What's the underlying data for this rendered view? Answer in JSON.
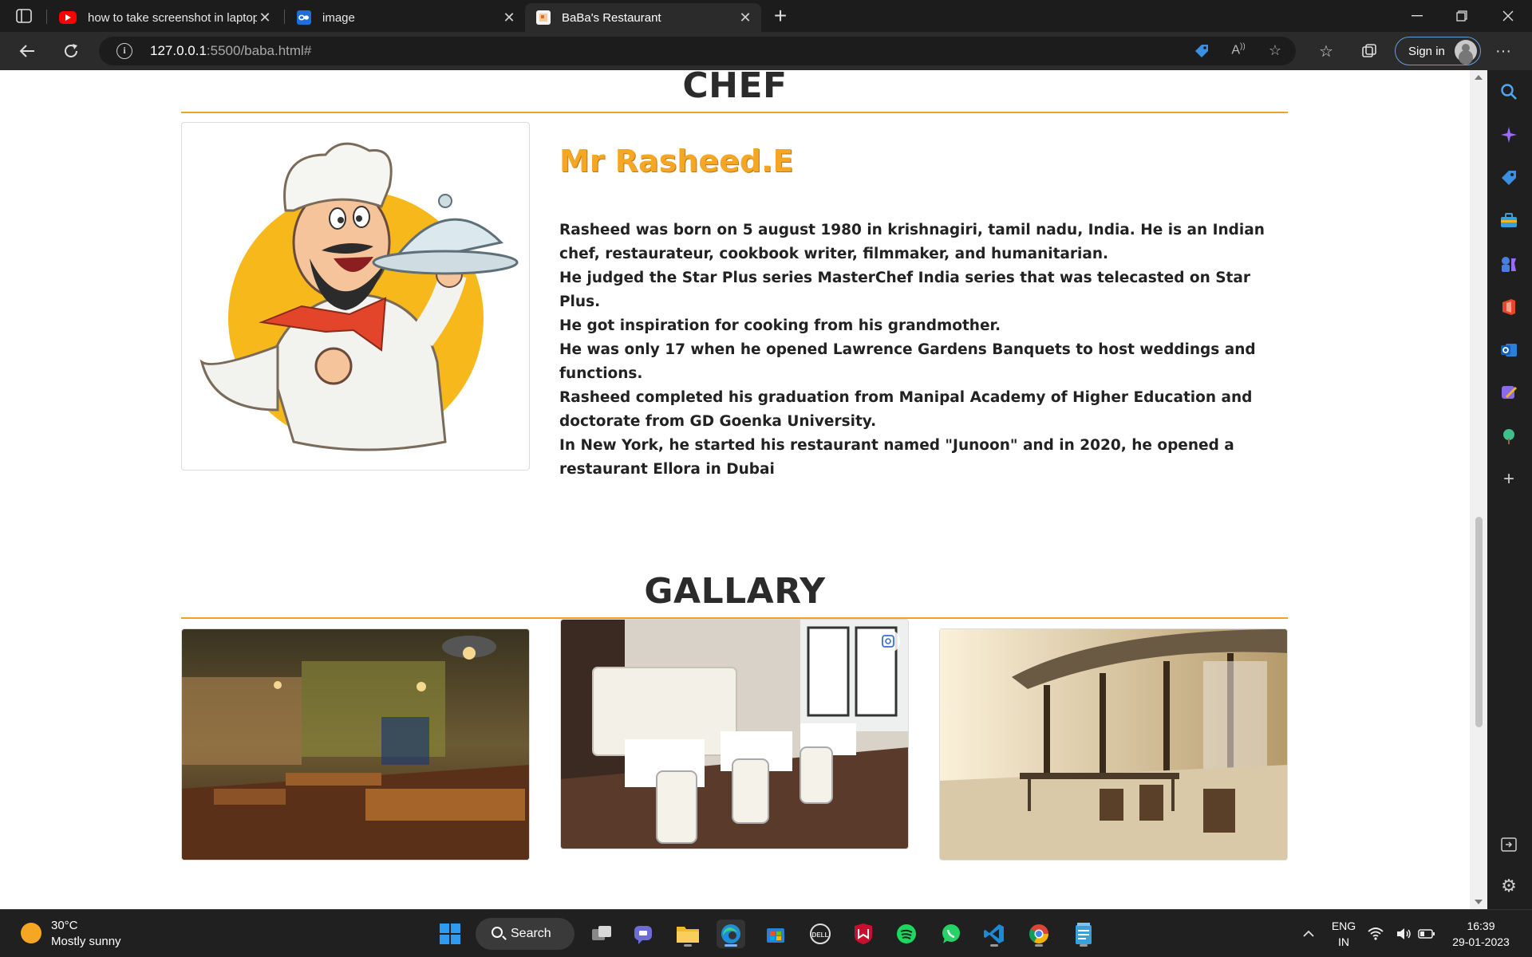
{
  "browser": {
    "tabs": [
      {
        "title": "how to take screenshot in laptop",
        "close": "✕"
      },
      {
        "title": "image",
        "close": "✕"
      },
      {
        "title": "BaBa's Restaurant",
        "close": "✕"
      }
    ],
    "new_tab": "+",
    "url_host": "127.0.0.1",
    "url_path": ":5500/baba.html#",
    "sign_in": "Sign in"
  },
  "chef": {
    "heading": "CHEF",
    "name": "Mr Rasheed.E",
    "bio": [
      "Rasheed was born on 5 august 1980 in krishnagiri, tamil nadu, India. He is an Indian chef, restaurateur, cookbook writer, filmmaker, and humanitarian.",
      "He judged the Star Plus series MasterChef India series that was telecasted on Star Plus.",
      "He got inspiration for cooking from his grandmother.",
      "He was only 17 when he opened Lawrence Gardens Banquets to host weddings and functions.",
      "Rasheed completed his graduation from Manipal Academy of Higher Education and doctorate from GD Goenka University.",
      "In New York, he started his restaurant named \"Junoon\" and in 2020, he opened a restaurant Ellora in Dubai"
    ]
  },
  "gallery": {
    "heading": "GALLARY"
  },
  "taskbar": {
    "temperature": "30°C",
    "weather": "Mostly sunny",
    "search": "Search",
    "lang1": "ENG",
    "lang2": "IN",
    "time": "16:39",
    "date": "29-01-2023"
  }
}
